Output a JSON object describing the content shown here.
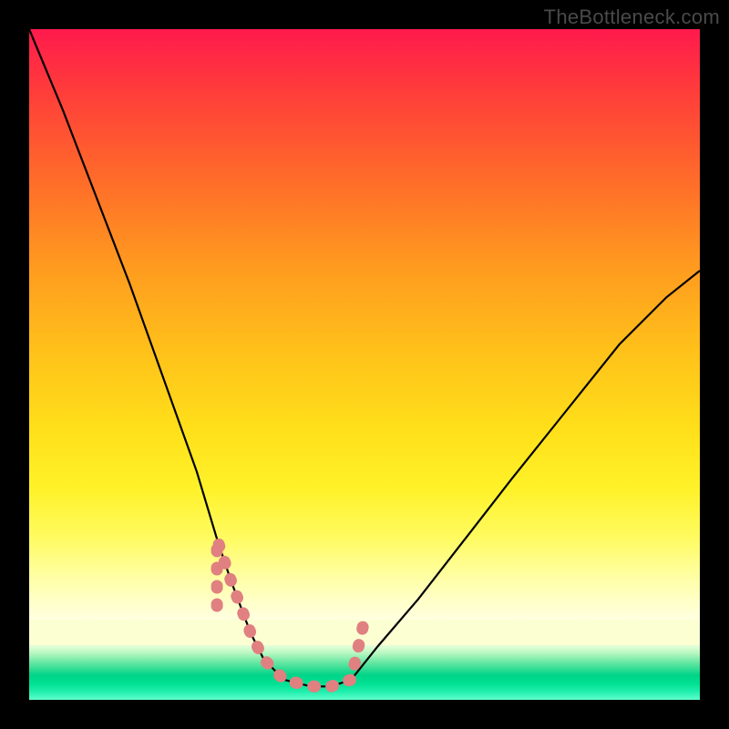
{
  "watermark": "TheBottleneck.com",
  "chart_data": {
    "type": "line",
    "title": "",
    "xlabel": "",
    "ylabel": "",
    "xlim": [
      0,
      100
    ],
    "ylim": [
      0,
      100
    ],
    "grid": false,
    "legend": false,
    "series": [
      {
        "name": "bottleneck-curve",
        "x": [
          0,
          5,
          10,
          15,
          20,
          25,
          28,
          30,
          33,
          35,
          38,
          42,
          45,
          48,
          52,
          58,
          65,
          72,
          80,
          88,
          95,
          100
        ],
        "y": [
          100,
          88,
          75,
          62,
          48,
          34,
          24,
          18,
          10,
          6,
          3,
          2,
          2,
          3,
          8,
          15,
          24,
          33,
          43,
          53,
          60,
          64
        ]
      }
    ],
    "annotations": [
      {
        "name": "valley-marker",
        "style": "salmon-bold",
        "x_range": [
          30,
          48
        ],
        "y_approx": 2
      }
    ],
    "background": {
      "type": "vertical-gradient",
      "stops": [
        {
          "pos": 0.0,
          "color": "#ff1a4d"
        },
        {
          "pos": 0.4,
          "color": "#ff9a1f"
        },
        {
          "pos": 0.78,
          "color": "#fff22a"
        },
        {
          "pos": 0.9,
          "color": "#fcffd2"
        },
        {
          "pos": 0.95,
          "color": "#2cdc92"
        },
        {
          "pos": 1.0,
          "color": "#60ffcc"
        }
      ]
    }
  }
}
